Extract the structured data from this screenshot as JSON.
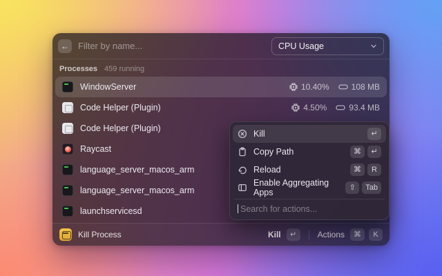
{
  "window": {
    "search": {
      "placeholder": "Filter by name..."
    },
    "dropdown": {
      "value": "CPU Usage"
    },
    "section": {
      "label": "Processes",
      "count": "459 running"
    },
    "processes": [
      {
        "name": "WindowServer",
        "icon": "terminal",
        "cpu": "10.40%",
        "mem": "108 MB",
        "selected": true
      },
      {
        "name": "Code Helper (Plugin)",
        "icon": "light",
        "cpu": "4.50%",
        "mem": "93.4 MB",
        "selected": false
      },
      {
        "name": "Code Helper (Plugin)",
        "icon": "light",
        "selected": false
      },
      {
        "name": "Raycast",
        "icon": "raycast",
        "selected": false
      },
      {
        "name": "language_server_macos_arm",
        "icon": "terminal",
        "selected": false
      },
      {
        "name": "language_server_macos_arm",
        "icon": "terminal",
        "selected": false
      },
      {
        "name": "launchservicesd",
        "icon": "terminal",
        "selected": false
      }
    ],
    "action_menu": {
      "items": [
        {
          "label": "Kill",
          "icon": "kill-icon",
          "keys": [
            "↵"
          ],
          "selected": true
        },
        {
          "label": "Copy Path",
          "icon": "clipboard-icon",
          "keys": [
            "⌘",
            "↵"
          ],
          "selected": false
        },
        {
          "label": "Reload",
          "icon": "reload-icon",
          "keys": [
            "⌘",
            "R"
          ],
          "selected": false
        },
        {
          "label": "Enable Aggregating Apps",
          "icon": "window-icon",
          "keys": [
            "⇧",
            "Tab"
          ],
          "selected": false
        }
      ],
      "search_placeholder": "Search for actions..."
    },
    "footer": {
      "app_name": "Kill Process",
      "primary_action": "Kill",
      "primary_key": "↵",
      "actions_label": "Actions",
      "actions_keys": [
        "⌘",
        "K"
      ]
    }
  },
  "icons": {
    "back": "←"
  },
  "colors": {
    "footer_app_icon": "#e8b53e",
    "terminal_green": "#3fc24f",
    "raycast_red": "#ff6b5e",
    "selection_highlight": "rgba(255,255,255,0.12)",
    "panel_bg": "rgba(28,21,31,0.74)",
    "popup_bg": "rgba(47,39,56,0.97)"
  }
}
